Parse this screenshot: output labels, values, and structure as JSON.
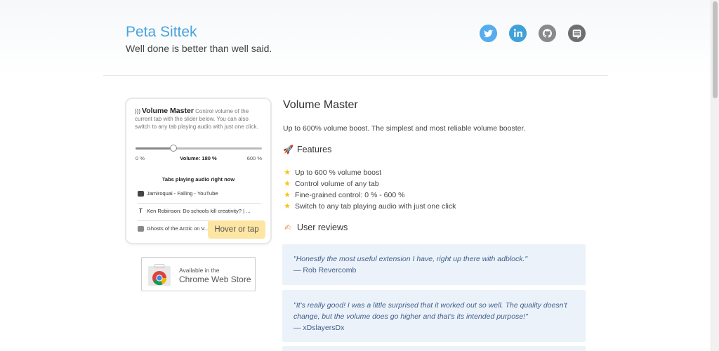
{
  "header": {
    "title": "Peta Sittek",
    "tagline": "Well done is better than well said.",
    "social": [
      {
        "icon": "twitter-icon",
        "color": "#55acee"
      },
      {
        "icon": "linkedin-icon",
        "color": "#3fa1d8"
      },
      {
        "icon": "github-icon",
        "color": "#8a8a8a"
      },
      {
        "icon": "stackexchange-icon",
        "color": "#6f6f6f"
      }
    ]
  },
  "extension": {
    "name": "Volume Master",
    "description": "Control volume of the current tab with the slider below. You can also switch to any tab playing audio with just one click.",
    "min_label": "0 %",
    "volume_label": "Volume: 180 %",
    "max_label": "600 %",
    "volume_value": 180,
    "volume_max": 600,
    "tabs_title": "Tabs playing audio right now",
    "tabs": [
      {
        "title": "Jamiroquai - Falling - YouTube",
        "icon": "youtube-icon"
      },
      {
        "title": "Ken Robinson: Do schools kill creativity? | ...",
        "icon": "ted-icon"
      },
      {
        "title": "Ghosts of the Arctic on V...",
        "icon": "vimeo-icon"
      }
    ],
    "hover_label": "Hover or tap"
  },
  "store": {
    "small": "Available in the",
    "big": "Chrome Web Store"
  },
  "main": {
    "title": "Volume Master",
    "description": "Up to 600% volume boost. The simplest and most reliable volume booster.",
    "features_heading": "Features",
    "features": [
      "Up to 600 % volume boost",
      "Control volume of any tab",
      "Fine-grained control: 0 % - 600 %",
      "Switch to any tab playing audio with just one click"
    ],
    "reviews_heading": "User reviews",
    "reviews": [
      {
        "quote": "\"Honestly the most useful extension I have, right up there with adblock.\"",
        "author": "— Rob Revercomb"
      },
      {
        "quote": "\"It's really good! I was a little surprised that it worked out so well. The quality doesn't change, but the volume does go higher and that's its intended purpose!\"",
        "author": "— xDslayersDx"
      }
    ]
  },
  "colors": {
    "accent": "#4aa3df",
    "review_bg": "#ecf2fa",
    "review_text": "#3f5f8a",
    "hover_badge": "#fde6a3",
    "star": "#f5c518"
  }
}
